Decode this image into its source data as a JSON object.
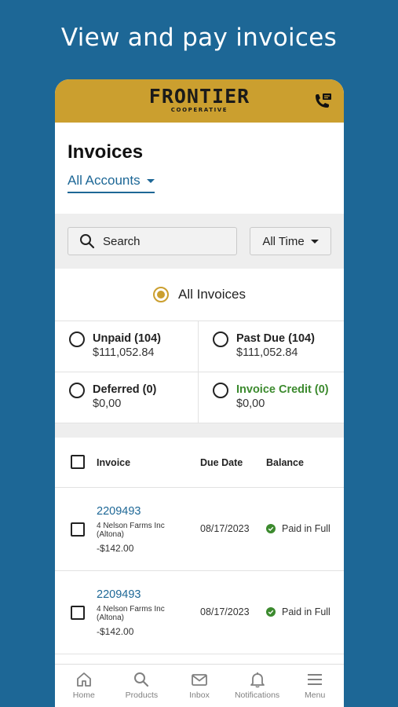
{
  "headline": "View and pay invoices",
  "header": {
    "logo_main": "FRONTIER",
    "logo_sub": "COOPERATIVE",
    "phone_icon": "phone-message-icon"
  },
  "page": {
    "title": "Invoices",
    "account_select": "All Accounts"
  },
  "filters": {
    "search_label": "Search",
    "time_select": "All Time"
  },
  "invoice_filter": {
    "all_label": "All Invoices",
    "options": [
      {
        "label": "Unpaid (104)",
        "amount": "$111,052.84"
      },
      {
        "label": "Past Due (104)",
        "amount": "$111,052.84"
      },
      {
        "label": "Deferred (0)",
        "amount": "$0,00"
      },
      {
        "label": "Invoice Credit (0)",
        "amount": "$0,00"
      }
    ]
  },
  "table": {
    "headers": {
      "invoice": "Invoice",
      "due_date": "Due Date",
      "balance": "Balance"
    },
    "rows": [
      {
        "number": "2209493",
        "name": "4 Nelson Farms Inc (Altona)",
        "amount": "-$142.00",
        "due_date": "08/17/2023",
        "status": "Paid in Full"
      },
      {
        "number": "2209493",
        "name": "4 Nelson Farms Inc (Altona)",
        "amount": "-$142.00",
        "due_date": "08/17/2023",
        "status": "Paid in Full"
      }
    ]
  },
  "nav": {
    "items": [
      {
        "label": "Home",
        "icon": "home-icon"
      },
      {
        "label": "Products",
        "icon": "search-icon"
      },
      {
        "label": "Inbox",
        "icon": "mail-icon"
      },
      {
        "label": "Notifications",
        "icon": "bell-icon"
      },
      {
        "label": "Menu",
        "icon": "menu-icon"
      }
    ]
  },
  "colors": {
    "background": "#1d6796",
    "header_gold": "#cb9f2f",
    "link_blue": "#1d6796",
    "success_green": "#3c8a2e"
  }
}
